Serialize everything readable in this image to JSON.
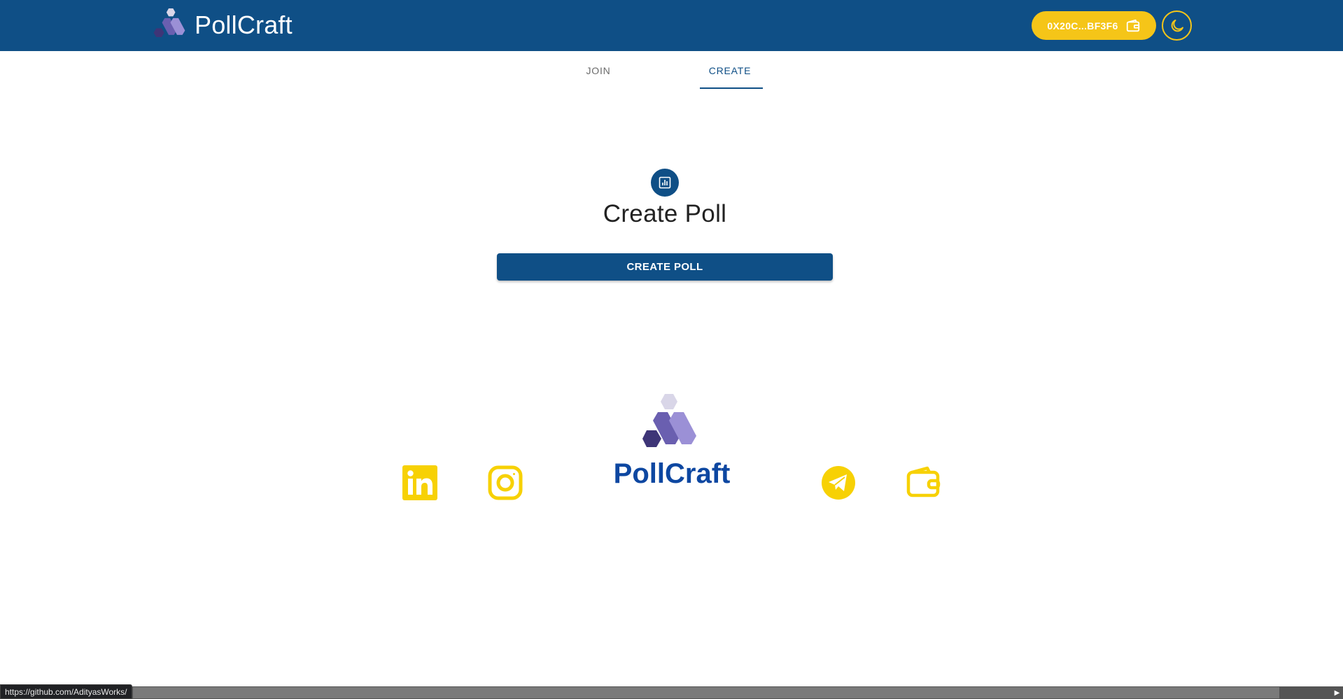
{
  "app": {
    "title": "PollCraft"
  },
  "header": {
    "wallet_address": "0X20C...BF3F6",
    "wallet_icon": "wallet-icon",
    "theme_icon": "moon-icon"
  },
  "tabs": [
    {
      "label": "JOIN",
      "active": false
    },
    {
      "label": "CREATE",
      "active": true
    }
  ],
  "main": {
    "icon": "poll-chart-icon",
    "title": "Create Poll",
    "button_label": "CREATE POLL"
  },
  "footer": {
    "title": "PollCraft",
    "socials": [
      {
        "name": "linkedin-icon"
      },
      {
        "name": "instagram-icon"
      },
      {
        "name": "telegram-icon"
      },
      {
        "name": "wallet-icon"
      }
    ]
  },
  "status_bar": {
    "url": "https://github.com/AdityasWorks/"
  },
  "colors": {
    "primary": "#0f4f86",
    "accent": "#f5c518",
    "footer_title": "#0d47a1"
  }
}
